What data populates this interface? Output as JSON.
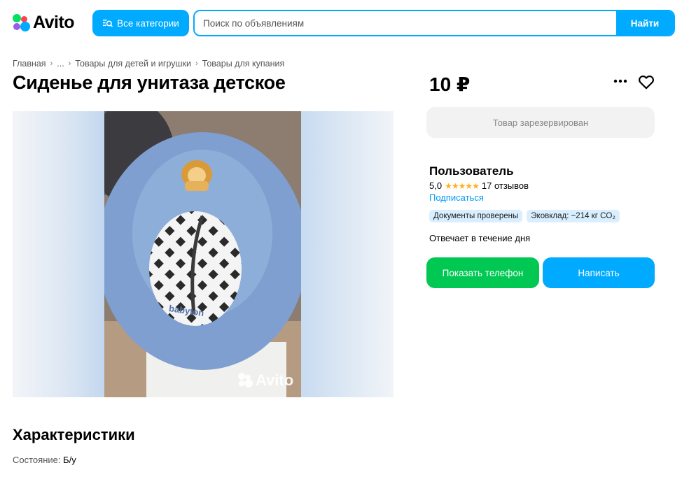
{
  "header": {
    "logo_text": "Avito",
    "categories_label": "Все категории",
    "search_placeholder": "Поиск по объявлениям",
    "search_button": "Найти",
    "brand_color": "#00aaff"
  },
  "breadcrumb": [
    "Главная",
    "...",
    "Товары для детей и игрушки",
    "Товары для купания"
  ],
  "listing": {
    "title": "Сиденье для унитаза детское",
    "price": "10 ₽",
    "photo_watermark": "Avito"
  },
  "actions": {
    "more_icon": "ellipsis-icon",
    "favorite_icon": "heart-icon",
    "reserved_label": "Товар зарезервирован"
  },
  "seller": {
    "name": "Пользователь",
    "rating_value": "5,0",
    "stars": "★★★★★",
    "reviews": "17 отзывов",
    "subscribe": "Подписаться",
    "badges": [
      "Документы проверены",
      "Эковклад: −214 кг CO₂"
    ],
    "responds": "Отвечает в течение дня"
  },
  "buttons": {
    "show_phone": "Показать телефон",
    "write": "Написать",
    "phone_color": "#00c853"
  },
  "characteristics": {
    "title": "Характеристики",
    "condition_label": "Состояние:",
    "condition_value": "Б/у"
  }
}
